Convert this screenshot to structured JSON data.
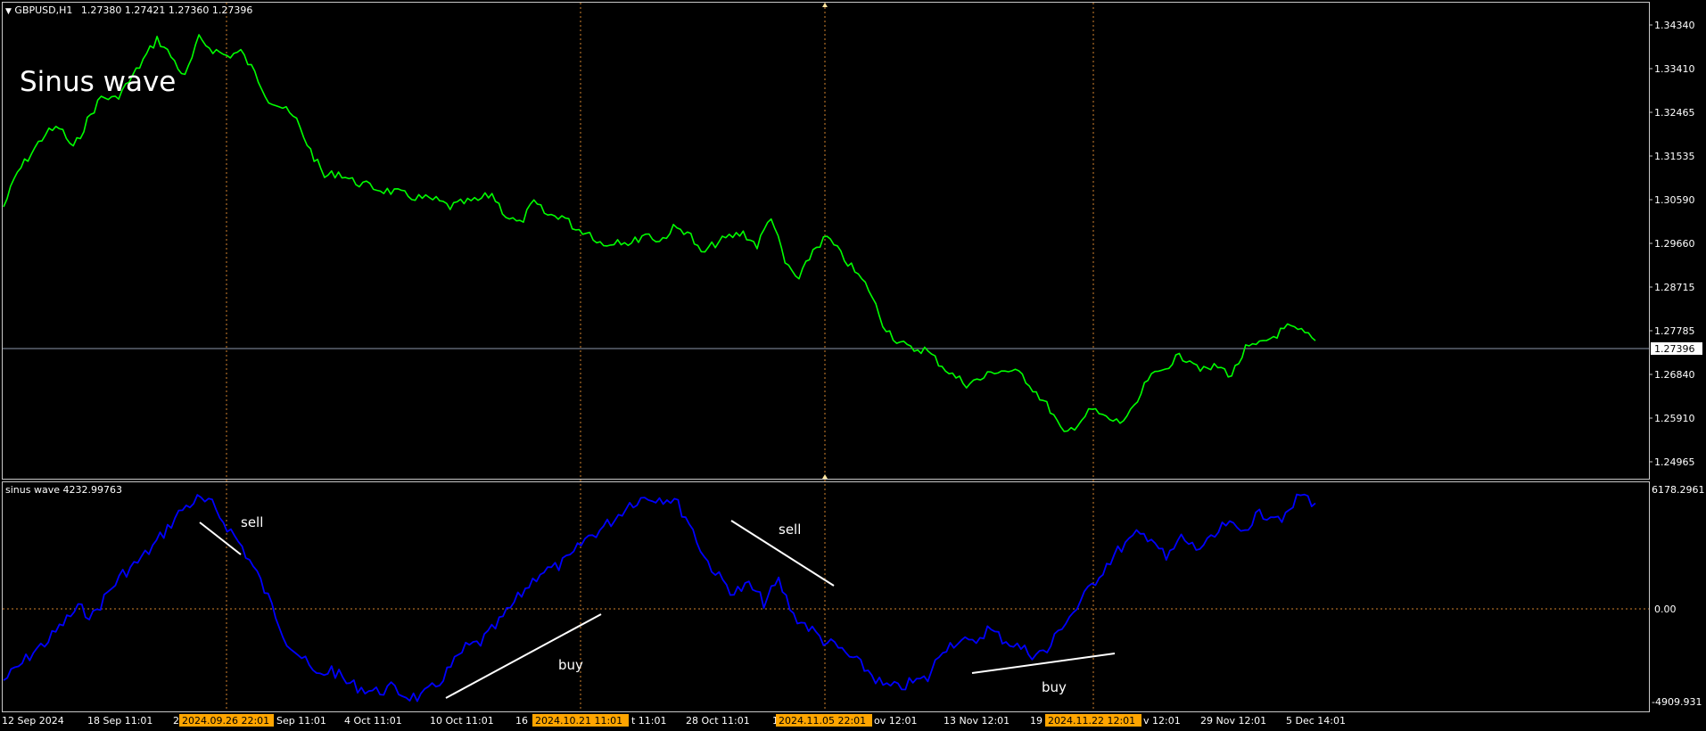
{
  "header": {
    "symbol": "GBPUSD,H1",
    "ohlc": "1.27380 1.27421 1.27360 1.27396"
  },
  "main_chart": {
    "title_overlay": "Sinus wave",
    "current_price_label": "1.27396",
    "y_ticks": [
      "1.34340",
      "1.33410",
      "1.32465",
      "1.31535",
      "1.30590",
      "1.29660",
      "1.28715",
      "1.27785",
      "1.26840",
      "1.25910",
      "1.24965"
    ],
    "ylim": [
      1.2459,
      1.3472
    ],
    "line_color": "#00ff00"
  },
  "indicator": {
    "title": "sinus wave 4232.99763",
    "y_ticks": [
      "6178.2961",
      "0.00",
      "-4909.931"
    ],
    "ylim": [
      -4909.931,
      6178.2961
    ],
    "line_color": "#0000ff",
    "annotations": [
      "sell",
      "sell",
      "buy",
      "buy"
    ]
  },
  "time_axis": {
    "labels": [
      "12 Sep 2024",
      "18 Sep 11:01",
      "2",
      "Sep 11:01",
      "4 Oct 11:01",
      "10 Oct 11:01",
      "16",
      "t 11:01",
      "28 Oct 11:01",
      "1",
      "ov 12:01",
      "13 Nov 12:01",
      "19",
      "v 12:01",
      "29 Nov 12:01",
      "5 Dec 14:01"
    ],
    "highlighted": [
      "2024.09.26 22:01",
      "2024.10.21 11:01",
      "2024.11.05 22:01",
      "2024.11.22 12:01"
    ],
    "highlight_color": "#ffa500"
  },
  "chart_data": [
    {
      "type": "line",
      "title": "GBPUSD,H1",
      "series": [
        {
          "name": "GBPUSD,H1",
          "values": [
            1.305,
            1.313,
            1.3175,
            1.322,
            1.3235,
            1.3185,
            1.325,
            1.3305,
            1.33,
            1.334,
            1.339,
            1.344,
            1.34,
            1.335,
            1.344,
            1.3415,
            1.34,
            1.341,
            1.336,
            1.33,
            1.328,
            1.325,
            1.318,
            1.312,
            1.313,
            1.311,
            1.31,
            1.309,
            1.3085,
            1.3075,
            1.307,
            1.3065,
            1.305,
            1.306,
            1.3065,
            1.308,
            1.303,
            1.301,
            1.306,
            1.303,
            1.303,
            1.3,
            1.299,
            1.296,
            1.2975,
            1.2965,
            1.299,
            1.297,
            1.3,
            1.2995,
            1.294,
            1.2965,
            1.298,
            1.299,
            1.296,
            1.303,
            1.292,
            1.288,
            1.295,
            1.298,
            1.294,
            1.29,
            1.286,
            1.278,
            1.274,
            1.272,
            1.272,
            1.269,
            1.266,
            1.264,
            1.265,
            1.267,
            1.267,
            1.266,
            1.262,
            1.258,
            1.252,
            1.255,
            1.258,
            1.256,
            1.255,
            1.258,
            1.265,
            1.267,
            1.27,
            1.27,
            1.267,
            1.268,
            1.266,
            1.272,
            1.273,
            1.275,
            1.277,
            1.276,
            1.274
          ]
        }
      ]
    },
    {
      "type": "line",
      "title": "sinus wave 4232.99763",
      "series": [
        {
          "name": "sinus wave",
          "values": [
            -3800,
            -3100,
            -2300,
            -1700,
            -800,
            0,
            -400,
            800,
            1800,
            2400,
            3200,
            4200,
            5200,
            5700,
            5400,
            4300,
            3200,
            1800,
            100,
            -1700,
            -2600,
            -3600,
            -3200,
            -3900,
            -4200,
            -4400,
            -4200,
            -4600,
            -4700,
            -4100,
            -3100,
            -2100,
            -1800,
            -1000,
            0,
            1000,
            1900,
            2100,
            2600,
            3600,
            4100,
            4700,
            5500,
            5800,
            5800,
            5700,
            4500,
            2700,
            1600,
            800,
            1200,
            300,
            1400,
            -400,
            -1000,
            -1700,
            -2100,
            -2700,
            -3300,
            -4100,
            -4200,
            -3900,
            -3700,
            -2100,
            -1700,
            -1900,
            -1100,
            -1600,
            -2000,
            -2400,
            -2300,
            -900,
            0,
            1200,
            2300,
            3200,
            3800,
            3800,
            2500,
            3700,
            3100,
            3500,
            4400,
            4000,
            4800,
            5000,
            4700,
            6000,
            5500
          ]
        }
      ]
    }
  ]
}
